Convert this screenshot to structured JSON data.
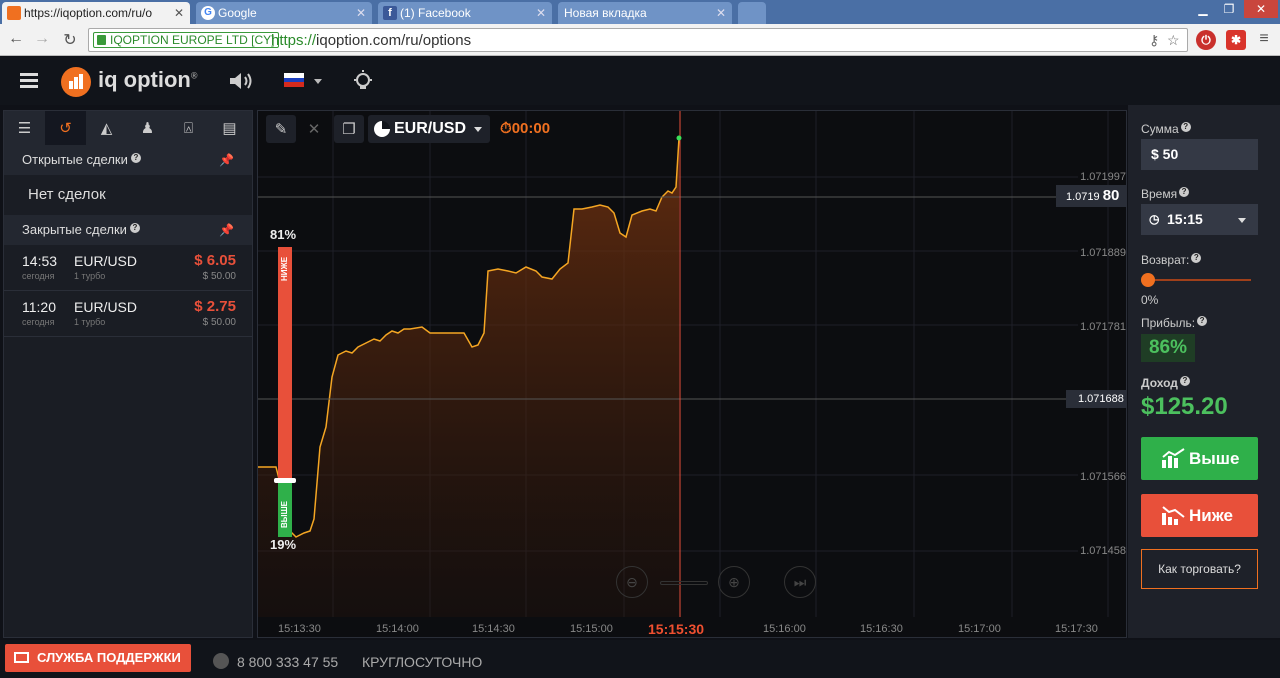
{
  "browser": {
    "tabs": [
      {
        "title": "https://iqoption.com/ru/o",
        "favicon_color": "#f07020"
      },
      {
        "title": "Google",
        "favicon_color": "#4285f4"
      },
      {
        "title": "(1) Facebook",
        "favicon_color": "#3b5998"
      },
      {
        "title": "Новая вкладка",
        "favicon_color": ""
      }
    ],
    "secure_label": "IQOPTION EUROPE LTD [CY]",
    "url_proto": "https://",
    "url_rest": "iqoption.com/ru/options"
  },
  "header": {
    "logo_text": "iq option",
    "logo_mark": "®"
  },
  "left": {
    "open_title": "Открытые сделки",
    "no_deals": "Нет сделок",
    "closed_title": "Закрытые сделки",
    "deals": [
      {
        "time": "14:53",
        "day": "сегодня",
        "pair": "EUR/USD",
        "type": "1 турбо",
        "profit": "$ 6.05",
        "stake": "$ 50.00"
      },
      {
        "time": "11:20",
        "day": "сегодня",
        "pair": "EUR/USD",
        "type": "1 турбо",
        "profit": "$ 2.75",
        "stake": "$ 50.00"
      }
    ]
  },
  "chart": {
    "asset": "EUR/USD",
    "timer": "00:00",
    "current_price_main": "1.0719",
    "current_price_big": "80",
    "level_price": "1.071688",
    "price_labels": [
      "1.071997",
      "1.071889",
      "1.071781",
      "1.071566",
      "1.071458"
    ],
    "time_labels": [
      "15:13:30",
      "15:14:00",
      "15:14:30",
      "15:15:00",
      "15:15:30",
      "15:16:00",
      "15:16:30",
      "15:17:00",
      "15:17:30"
    ],
    "current_time": "15:15:30",
    "sentiment": {
      "lower_pct": "81%",
      "higher_pct": "19%",
      "lower_label": "НИЖЕ",
      "higher_label": "ВЫШЕ",
      "lower_value": 81,
      "higher_value": 19
    },
    "accent_color": "#f5a623"
  },
  "right": {
    "amount_label": "Сумма",
    "amount_value": "$  50",
    "time_label": "Время",
    "time_value": "15:15",
    "return_label": "Возврат:",
    "return_value": "0%",
    "profit_label": "Прибыль:",
    "profit_value": "86%",
    "income_label": "Доход",
    "income_value": "$125.20",
    "higher_button": "Выше",
    "lower_button": "Ниже",
    "how_button": "Как торговать?",
    "higher_color": "#2fb04a",
    "lower_color": "#e8503a"
  },
  "footer": {
    "support": "СЛУЖБА ПОДДЕРЖКИ",
    "phone": "8 800 333 47 55",
    "hours": "КРУГЛОСУТОЧНО"
  }
}
